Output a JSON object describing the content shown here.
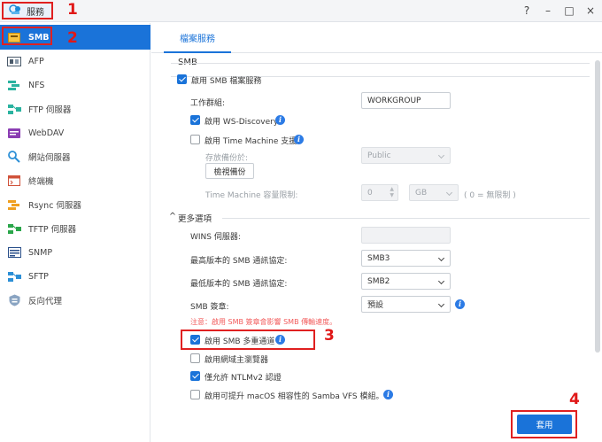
{
  "window": {
    "title": "服務",
    "controls": [
      "?",
      "–",
      "□",
      "×"
    ]
  },
  "annotations": [
    "1",
    "2",
    "3",
    "4"
  ],
  "sidebar": {
    "items": [
      {
        "label": "SMB",
        "icon": "smb-icon",
        "active": true
      },
      {
        "label": "AFP",
        "icon": "afp-icon"
      },
      {
        "label": "NFS",
        "icon": "nfs-icon"
      },
      {
        "label": "FTP 伺服器",
        "icon": "ftp-icon"
      },
      {
        "label": "WebDAV",
        "icon": "webdav-icon"
      },
      {
        "label": "網站伺服器",
        "icon": "web-server-icon"
      },
      {
        "label": "終端機",
        "icon": "terminal-icon"
      },
      {
        "label": "Rsync 伺服器",
        "icon": "rsync-icon"
      },
      {
        "label": "TFTP 伺服器",
        "icon": "tftp-icon"
      },
      {
        "label": "SNMP",
        "icon": "snmp-icon"
      },
      {
        "label": "SFTP",
        "icon": "sftp-icon"
      },
      {
        "label": "反向代理",
        "icon": "reverse-proxy-icon"
      }
    ]
  },
  "tabs": [
    {
      "label": "檔案服務"
    }
  ],
  "smb": {
    "section_title": "SMB",
    "enable_label": "啟用 SMB 檔案服務",
    "enable_checked": true,
    "workgroup_label": "工作群組:",
    "workgroup_value": "WORKGROUP",
    "ws_discovery_label": "啟用 WS-Discovery",
    "ws_discovery_checked": true,
    "time_machine_label": "啟用 Time Machine 支援",
    "time_machine_checked": false,
    "storage_label": "存放備份於:",
    "storage_value": "Public",
    "check_backup_button": "檢視備份",
    "tm_quota_label": "Time Machine 容量限制:",
    "tm_quota_value": "0",
    "tm_quota_unit": "GB",
    "tm_quota_hint": "( 0 = 無限制 )"
  },
  "more": {
    "section_title": "更多選項",
    "wins_label": "WINS 伺服器:",
    "wins_value": "",
    "max_protocol_label": "最高版本的 SMB 通訊協定:",
    "max_protocol_value": "SMB3",
    "min_protocol_label": "最低版本的 SMB 通訊協定:",
    "min_protocol_value": "SMB2",
    "signing_label": "SMB 簽章:",
    "signing_value": "預設",
    "warning": "注意：啟用 SMB 簽章會影響 SMB 傳輸速度。",
    "multichannel_label": "啟用 SMB 多重通道",
    "multichannel_checked": true,
    "browser_label": "啟用網域主瀏覽器",
    "browser_checked": false,
    "ntlm_label": "僅允許 NTLMv2 認證",
    "ntlm_checked": true,
    "macos_label": "啟用可提升 macOS 相容性的 Samba VFS 模組。",
    "macos_checked": false
  },
  "footer": {
    "apply_label": "套用"
  },
  "colors": {
    "accent": "#1a73d9",
    "annotation": "#e02020",
    "warning": "#f25b5b"
  }
}
